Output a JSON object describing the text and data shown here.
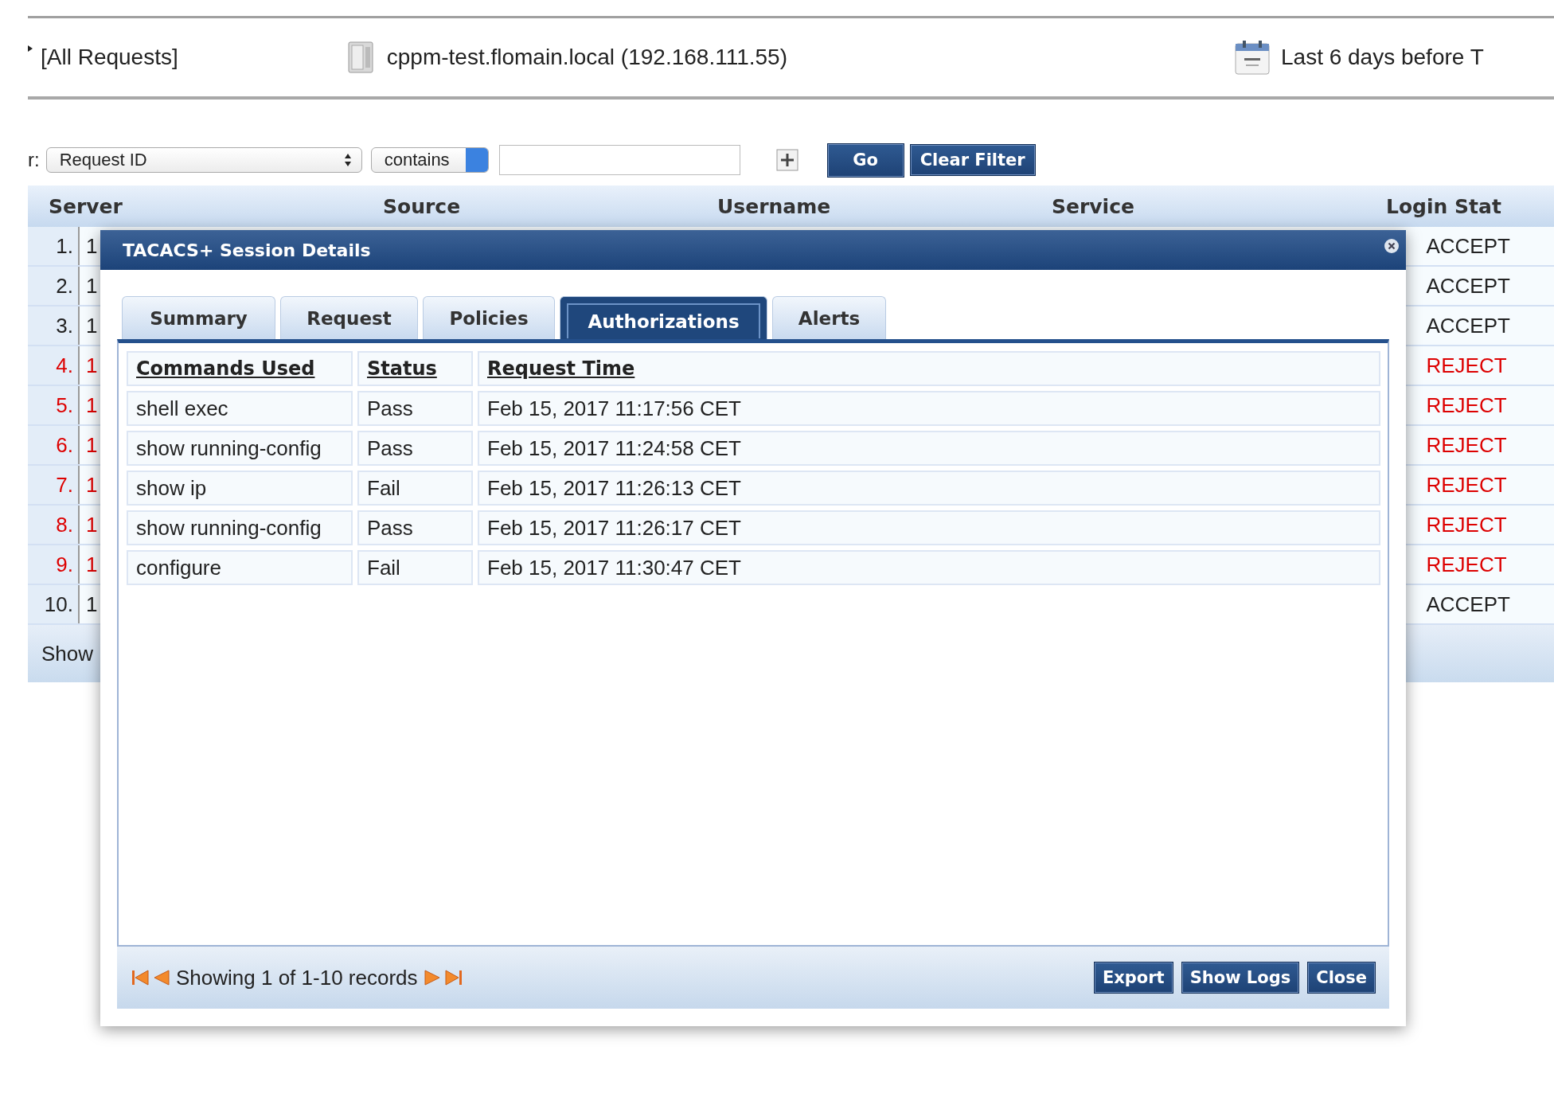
{
  "header": {
    "scope": "[All Requests]",
    "server": "cppm-test.flomain.local (192.168.111.55)",
    "date_range": "Last 6 days before T"
  },
  "filter": {
    "label": "r:",
    "field": "Request ID",
    "operator": "contains",
    "buttons": [
      "Go",
      "Clear Filter"
    ]
  },
  "table": {
    "columns": [
      "Server",
      "Source",
      "Username",
      "Service",
      "Login Stat"
    ],
    "rows": [
      {
        "number": "1.",
        "server": "1",
        "status": "ACCEPT",
        "color": "#222222"
      },
      {
        "number": "2.",
        "server": "1",
        "status": "ACCEPT",
        "color": "#222222"
      },
      {
        "number": "3.",
        "server": "1",
        "status": "ACCEPT",
        "color": "#222222"
      },
      {
        "number": "4.",
        "server": "1",
        "status": "REJECT",
        "color": "#dd0000"
      },
      {
        "number": "5.",
        "server": "1",
        "status": "REJECT",
        "color": "#dd0000"
      },
      {
        "number": "6.",
        "server": "1",
        "status": "REJECT",
        "color": "#dd0000"
      },
      {
        "number": "7.",
        "server": "1",
        "status": "REJECT",
        "color": "#dd0000"
      },
      {
        "number": "8.",
        "server": "1",
        "status": "REJECT",
        "color": "#dd0000"
      },
      {
        "number": "9.",
        "server": "1",
        "status": "REJECT",
        "color": "#dd0000"
      },
      {
        "number": "10.",
        "server": "1",
        "status": "ACCEPT",
        "color": "#222222"
      }
    ],
    "footer": "Show"
  },
  "dialog": {
    "title": "TACACS+ Session Details",
    "tabs": [
      {
        "label": "Summary",
        "selected": false
      },
      {
        "label": "Request",
        "selected": false
      },
      {
        "label": "Policies",
        "selected": false
      },
      {
        "label": "Authorizations",
        "selected": true
      },
      {
        "label": "Alerts",
        "selected": false
      }
    ],
    "columns": [
      "Commands Used",
      "Status",
      "Request Time"
    ],
    "rows": [
      {
        "command": "shell exec",
        "status": "Pass",
        "time": "Feb 15, 2017 11:17:56 CET"
      },
      {
        "command": "show running-config",
        "status": "Pass",
        "time": "Feb 15, 2017 11:24:58 CET"
      },
      {
        "command": "show ip",
        "status": "Fail",
        "time": "Feb 15, 2017 11:26:13 CET"
      },
      {
        "command": "show running-config",
        "status": "Pass",
        "time": "Feb 15, 2017 11:26:17 CET"
      },
      {
        "command": "configure",
        "status": "Fail",
        "time": "Feb 15, 2017 11:30:47 CET"
      }
    ],
    "pager": "Showing 1 of 1-10 records",
    "buttons": [
      "Export",
      "Show Logs",
      "Close"
    ]
  }
}
